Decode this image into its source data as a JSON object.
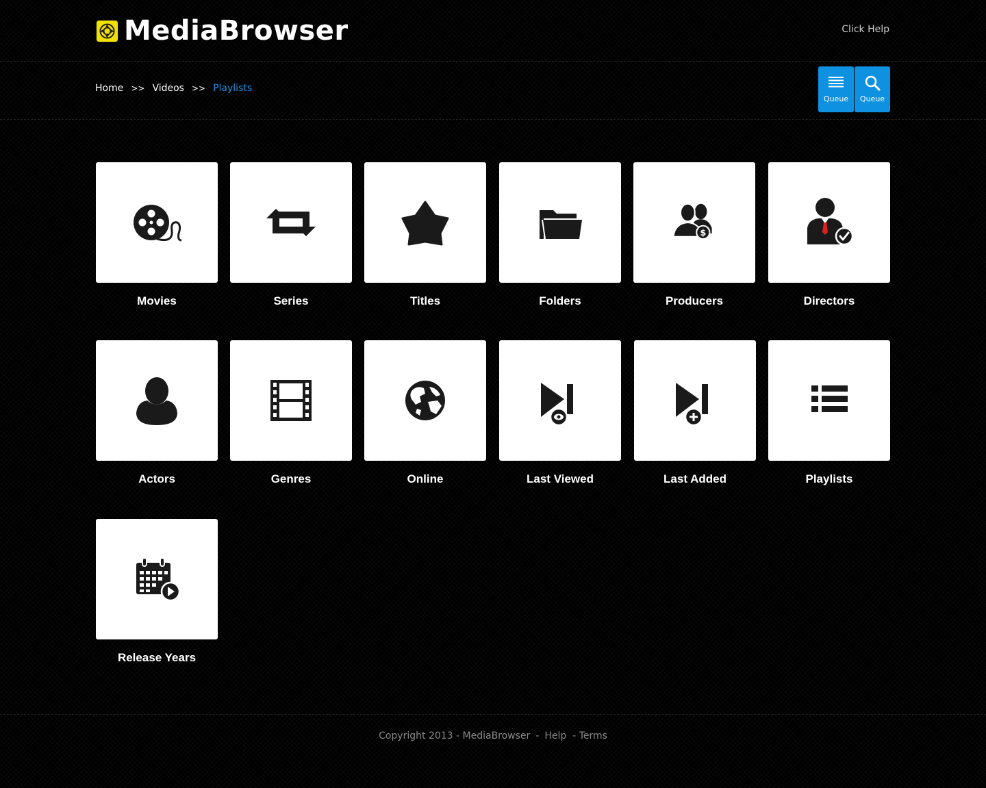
{
  "app": {
    "title": "MediaBrowser",
    "logo_icon": "mediabrowser-logo-icon",
    "help_link": "Click Help"
  },
  "breadcrumb": {
    "items": [
      "Home",
      "Videos",
      "Playlists"
    ],
    "separator": ">>"
  },
  "toolbar": {
    "buttons": [
      {
        "label": "Queue",
        "icon": "list-icon"
      },
      {
        "label": "Queue",
        "icon": "search-icon"
      }
    ]
  },
  "tiles": [
    {
      "label": "Movies",
      "icon": "film-reel-icon"
    },
    {
      "label": "Series",
      "icon": "repeat-icon"
    },
    {
      "label": "Titles",
      "icon": "star-icon"
    },
    {
      "label": "Folders",
      "icon": "folder-icon"
    },
    {
      "label": "Producers",
      "icon": "users-dollar-icon"
    },
    {
      "label": "Directors",
      "icon": "businessman-check-icon"
    },
    {
      "label": "Actors",
      "icon": "person-icon"
    },
    {
      "label": "Genres",
      "icon": "film-strip-icon"
    },
    {
      "label": "Online",
      "icon": "globe-icon"
    },
    {
      "label": "Last Viewed",
      "icon": "play-next-eye-icon"
    },
    {
      "label": "Last Added",
      "icon": "play-next-plus-icon"
    },
    {
      "label": "Playlists",
      "icon": "list-bullets-icon"
    },
    {
      "label": "Release Years",
      "icon": "calendar-play-icon"
    }
  ],
  "footer": {
    "copyright": "Copyright 2013 - MediaBrowser",
    "separator": "-",
    "help": "Help",
    "terms": "- Terms"
  },
  "colors": {
    "accent": "#0e91e0",
    "breadcrumb_active": "#1e8fe0",
    "logo_yellow": "#f2e000",
    "background": "#000000",
    "tile_background": "#ffffff"
  }
}
